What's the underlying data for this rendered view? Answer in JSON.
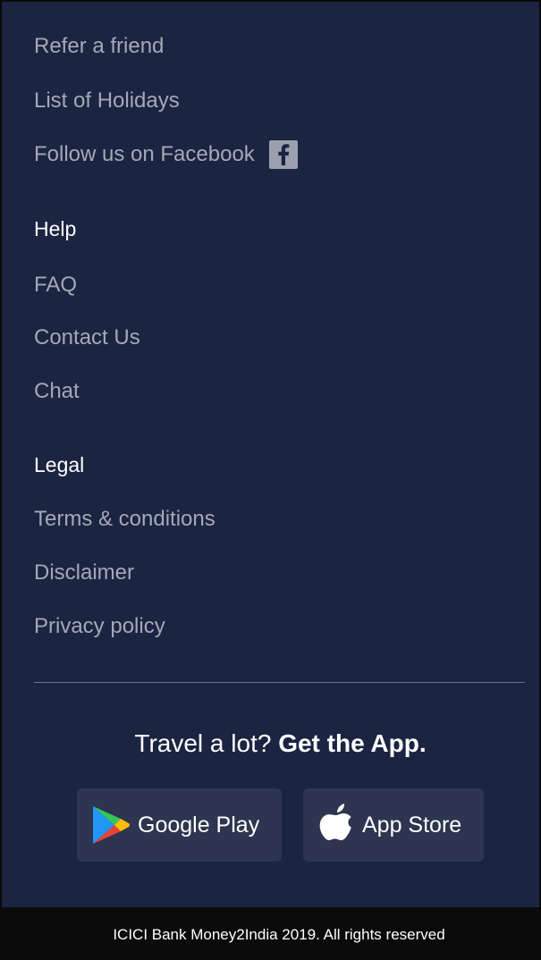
{
  "links_top": {
    "refer": "Refer a friend",
    "holidays": "List of Holidays",
    "facebook": "Follow us on Facebook"
  },
  "help": {
    "heading": "Help",
    "faq": "FAQ",
    "contact": "Contact Us",
    "chat": "Chat"
  },
  "legal": {
    "heading": "Legal",
    "terms": "Terms & conditions",
    "disclaimer": "Disclaimer",
    "privacy": "Privacy policy"
  },
  "promo": {
    "lead": "Travel a lot?",
    "strong": "Get the App."
  },
  "stores": {
    "google": "Google Play",
    "apple": "App Store"
  },
  "footer": {
    "copyright": "ICICI Bank Money2India 2019. All rights reserved"
  },
  "colors": {
    "background": "#1b2441",
    "link": "#a4a9b6",
    "heading": "#ffffff",
    "button": "#2d3550",
    "footer": "#0b0b0b"
  },
  "icons": [
    "facebook-icon",
    "google-play-icon",
    "apple-icon"
  ]
}
